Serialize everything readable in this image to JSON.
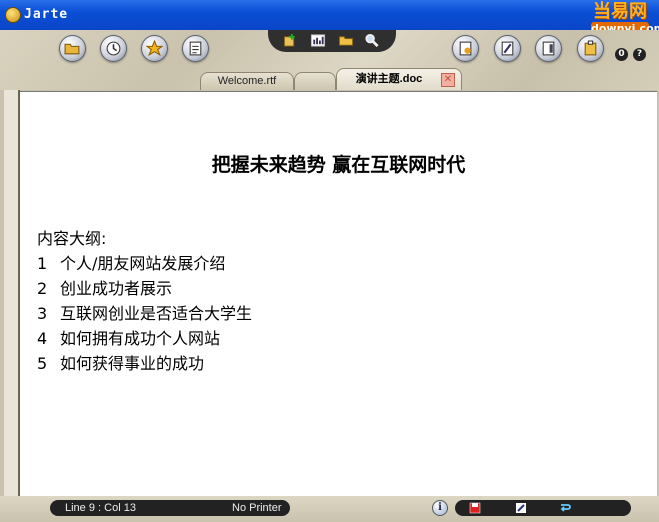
{
  "window": {
    "title": "Jarte"
  },
  "watermark": {
    "top": "当易网",
    "bottom": "downyi.com"
  },
  "toolbar": {
    "left_buttons": [
      "open-folder-icon",
      "clock-icon",
      "star-icon",
      "notepad-icon"
    ],
    "center_buttons": [
      "new-document-icon",
      "chart-icon",
      "folder-icon",
      "search-icon"
    ],
    "right_buttons": [
      "page-icon",
      "edit-icon",
      "book-icon",
      "clipboard-icon"
    ],
    "help_labels": [
      "0",
      "?"
    ]
  },
  "tabs": [
    {
      "label": "Welcome.rtf",
      "active": false
    },
    {
      "label": "",
      "active": false
    },
    {
      "label": "演讲主题.doc",
      "active": true
    }
  ],
  "document": {
    "title": "把握未来趋势 赢在互联网时代",
    "outline_heading": "内容大纲:",
    "items": [
      {
        "num": "1",
        "text": "个人/朋友网站发展介绍"
      },
      {
        "num": "2",
        "text": "创业成功者展示"
      },
      {
        "num": "3",
        "text": "互联网创业是否适合大学生"
      },
      {
        "num": "4",
        "text": "如何拥有成功个人网站"
      },
      {
        "num": "5",
        "text": "如何获得事业的成功"
      }
    ]
  },
  "status": {
    "position": "Line 9 : Col 13",
    "printer": "No Printer",
    "info_label": "i"
  },
  "colors": {
    "titlebar": "#0a4fd6",
    "accent": "#e36a00"
  }
}
